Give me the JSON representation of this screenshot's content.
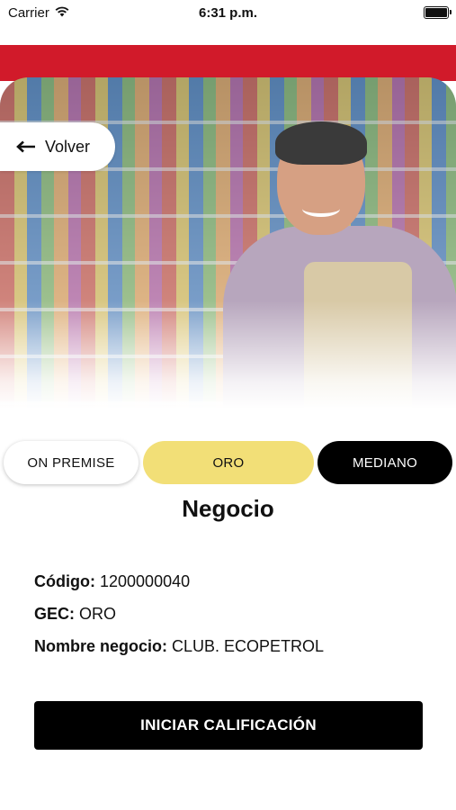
{
  "status_bar": {
    "carrier": "Carrier",
    "time": "6:31 p.m.",
    "icons": [
      "wifi-icon",
      "battery-icon"
    ]
  },
  "colors": {
    "brand_red": "#d11a2a",
    "gold": "#f2df77",
    "black": "#000000"
  },
  "header": {
    "back_label": "Volver",
    "back_icon": "arrow-left-icon",
    "hero_image": "shopkeeper-store-photo"
  },
  "tags": {
    "premise": "ON PREMISE",
    "gec": "ORO",
    "size": "MEDIANO"
  },
  "section": {
    "title": "Negocio"
  },
  "details": {
    "codigo_label": "Código:",
    "codigo_value": "1200000040",
    "gec_label": "GEC:",
    "gec_value": "ORO",
    "nombre_label": "Nombre negocio:",
    "nombre_value": "CLUB. ECOPETROL"
  },
  "actions": {
    "start_label": "INICIAR CALIFICACIÓN"
  }
}
